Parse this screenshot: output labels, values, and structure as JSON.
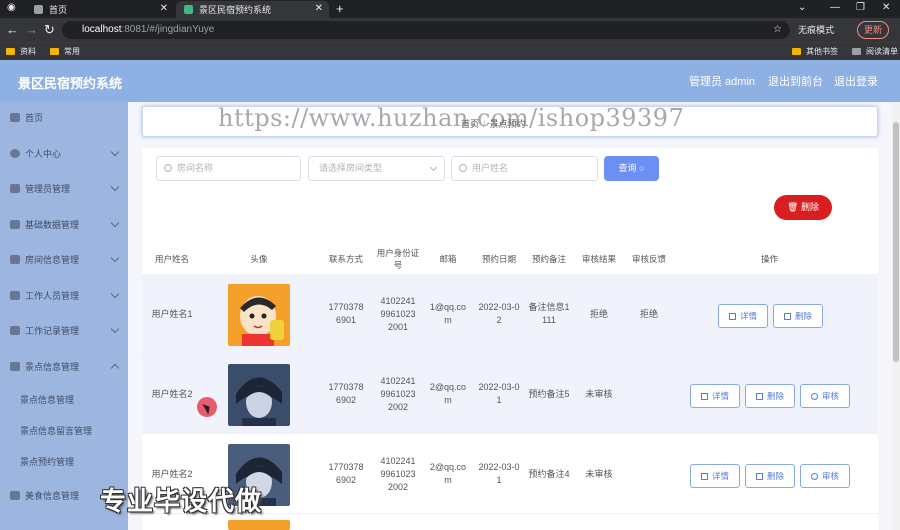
{
  "browser": {
    "tabs": [
      {
        "title": "首页"
      },
      {
        "title": "景区民宿预约系统"
      }
    ],
    "url_host": "localhost",
    "url_path": ":8081/#/jingdianYuye",
    "incognito": "无痕模式",
    "update": "更新",
    "bookmarks": [
      "资料",
      "常用"
    ],
    "bookmarks_right": [
      "其他书签",
      "阅读清单"
    ]
  },
  "header": {
    "title": "景区民宿预约系统",
    "admin": "管理员 admin",
    "back": "退出到前台",
    "logout": "退出登录"
  },
  "sidebar": {
    "items": [
      {
        "label": "首页"
      },
      {
        "label": "个人中心"
      },
      {
        "label": "管理员管理"
      },
      {
        "label": "基础数据管理"
      },
      {
        "label": "房间信息管理"
      },
      {
        "label": "工作人员管理"
      },
      {
        "label": "工作记录管理"
      },
      {
        "label": "景点信息管理"
      },
      {
        "label": "景点信息管理"
      },
      {
        "label": "景点信息留言管理"
      },
      {
        "label": "景点预约管理"
      },
      {
        "label": "美食信息管理"
      }
    ]
  },
  "breadcrumb": {
    "home": "首页",
    "current": "景点预约"
  },
  "watermark": "https://www.huzhan.com/ishop39397",
  "search": {
    "room_name_placeholder": "房间名称",
    "room_type_placeholder": "请选择房间类型",
    "user_name_placeholder": "用户姓名",
    "button": "查询"
  },
  "delete_button": "删除",
  "table": {
    "headers": [
      "用户姓名",
      "头像",
      "联系方式",
      "用户身份证号",
      "邮箱",
      "预约日期",
      "预约备注",
      "审核结果",
      "审核反馈",
      "操作"
    ],
    "rows": [
      {
        "name": "用户姓名1",
        "phone": "17703786901",
        "idcard": "410224199610232001",
        "email": "1@qq.com",
        "date": "2022-03-02",
        "note": "备注信息1111",
        "result": "拒绝",
        "feedback": "拒绝",
        "actions": [
          "详情",
          "删除"
        ]
      },
      {
        "name": "用户姓名2",
        "phone": "17703786902",
        "idcard": "410224199610232002",
        "email": "2@qq.com",
        "date": "2022-03-01",
        "note": "预约备注5",
        "result": "未审核",
        "feedback": "",
        "actions": [
          "详情",
          "删除",
          "审核"
        ]
      },
      {
        "name": "用户姓名2",
        "phone": "17703786902",
        "idcard": "410224199610232002",
        "email": "2@qq.com",
        "date": "2022-03-01",
        "note": "预约备注4",
        "result": "未审核",
        "feedback": "",
        "actions": [
          "详情",
          "删除",
          "审核"
        ]
      }
    ]
  },
  "banner": "专业毕设代做"
}
